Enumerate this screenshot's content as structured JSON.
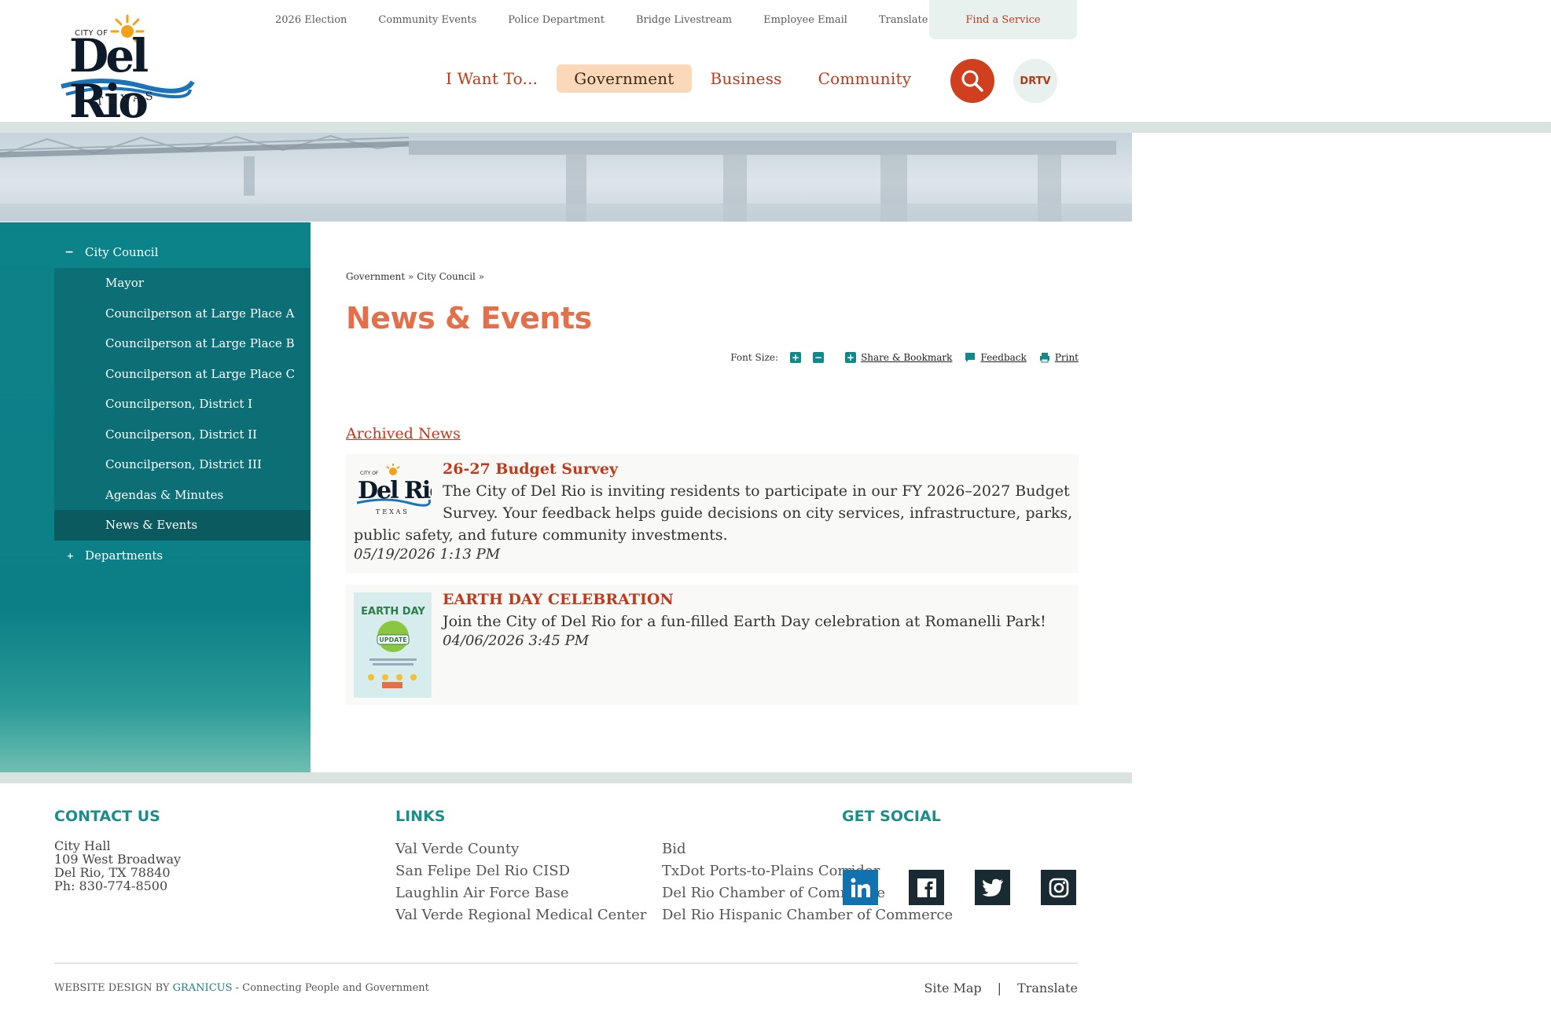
{
  "logo": {
    "city_of": "CITY OF",
    "name": "Del Rio",
    "state": "TEXAS"
  },
  "utility_nav": [
    "2026 Election",
    "Community Events",
    "Police Department",
    "Bridge Livestream",
    "Employee Email",
    "Translate"
  ],
  "find_service": "Find a Service",
  "main_nav": [
    {
      "label": "I Want To...",
      "active": false
    },
    {
      "label": "Government",
      "active": true
    },
    {
      "label": "Business",
      "active": false
    },
    {
      "label": "Community",
      "active": false
    }
  ],
  "drtv": "DRTV",
  "sidebar": {
    "toggle_open": "−",
    "toggle_closed": "+",
    "parent": "City Council",
    "children": [
      "Mayor",
      "Councilperson at Large Place A",
      "Councilperson at Large Place B",
      "Councilperson at Large Place C",
      "Councilperson, District I",
      "Councilperson, District II",
      "Councilperson, District III",
      "Agendas & Minutes",
      "News & Events"
    ],
    "current": "News & Events",
    "sibling": "Departments"
  },
  "breadcrumb": {
    "items": [
      "Government",
      "City Council"
    ],
    "separator": "»"
  },
  "page_title": "News & Events",
  "tools": {
    "font_size": "Font Size:",
    "plus": "+",
    "minus": "−",
    "share": "Share & Bookmark",
    "feedback": "Feedback",
    "print": "Print"
  },
  "archived_news": "Archived News",
  "news": [
    {
      "title": "26-27 Budget Survey",
      "body_lead": "The City of Del Rio is inviting residents to participate in our FY 2026–2027 Budget",
      "body_rest1": "Survey. Your feedback helps guide decisions on city services, infrastructure, parks,",
      "body_rest2": "public safety, and future community investments.",
      "date": "05/19/2026 1:13 PM"
    },
    {
      "title": "EARTH DAY CELEBRATION",
      "body": "Join the City of Del Rio for a fun-filled Earth Day celebration at Romanelli Park!",
      "date": "04/06/2026 3:45 PM",
      "thumb_text": {
        "top": "EARTH DAY",
        "badge": "UPDATE"
      }
    }
  ],
  "footer": {
    "contact_heading": "CONTACT US",
    "contact_lines": [
      "City Hall",
      "109 West Broadway",
      "Del Rio, TX 78840",
      "Ph: 830-774-8500"
    ],
    "links_heading": "LINKS",
    "links_col1": [
      "Val Verde County",
      "San Felipe Del Rio CISD",
      "Laughlin Air Force Base",
      "Val Verde Regional Medical Center"
    ],
    "links_col2": [
      "Bid",
      "TxDot Ports-to-Plains Corridor",
      "Del Rio Chamber of Commerce",
      "Del Rio Hispanic Chamber of Commerce"
    ],
    "social_heading": "GET SOCIAL",
    "social": [
      "linkedin-icon",
      "facebook-icon",
      "twitter-icon",
      "instagram-icon"
    ],
    "credit_prefix": "WEBSITE DESIGN BY ",
    "credit_brand": "GRANICUS",
    "credit_suffix": " - Connecting People and Government",
    "site_map": "Site Map",
    "separator": "|",
    "translate": "Translate"
  },
  "colors": {
    "accent": "#c0391a",
    "teal": "#0c8289",
    "title": "#e2704a",
    "nav_active_bg": "#fbd8b7"
  }
}
